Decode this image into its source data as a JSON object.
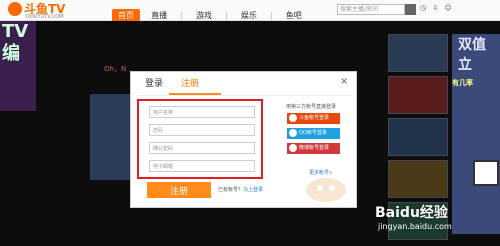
{
  "header": {
    "brand": "斗鱼TV",
    "site": "DOUYUTV.COM",
    "nav": [
      {
        "label": "首页",
        "active": true
      },
      {
        "label": "直播",
        "active": false
      },
      {
        "label": "游戏",
        "active": false
      },
      {
        "label": "娱乐",
        "active": false
      },
      {
        "label": "鱼吧",
        "active": false
      }
    ],
    "search_placeholder": "搜索主播/房间"
  },
  "background": {
    "left_banner": "TV\n编",
    "stream_text": "Oh，N",
    "right_promo": "双值\n立",
    "right_slogan": "有几率"
  },
  "modal": {
    "tabs": {
      "login": "登录",
      "register": "注册"
    },
    "close": "×",
    "fields": [
      {
        "placeholder": "用户名称"
      },
      {
        "placeholder": "密码"
      },
      {
        "placeholder": "确认密码"
      },
      {
        "placeholder": "电子邮箱"
      }
    ],
    "third_party_title": "用第三方帐号直接登录",
    "third_party": [
      {
        "label": "斗鱼帐号登录"
      },
      {
        "label": "QQ帐号登录"
      },
      {
        "label": "微博帐号登录"
      }
    ],
    "more_link": "更多帐号»",
    "register_button": "注册",
    "has_account_prefix": "已有帐号？",
    "login_link": "马上登录"
  },
  "watermark": {
    "main": "Baidu经验",
    "sub": "jingyan.baidu.com"
  },
  "colors": {
    "accent": "#ff8c1a",
    "highlight_border": "#e02020",
    "qq": "#20a0e0",
    "weibo": "#d0383b",
    "douyu": "#e8480c"
  }
}
